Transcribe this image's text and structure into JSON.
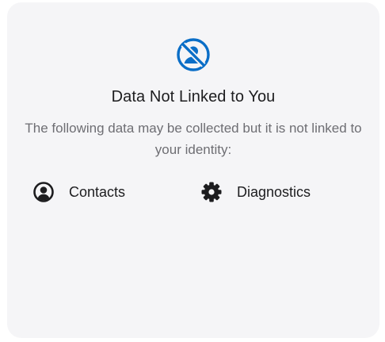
{
  "card": {
    "title": "Data Not Linked to You",
    "description": "The following data may be collected but it is not linked to your identity:",
    "header_icon": "unlinked-person-icon",
    "accent_color": "#0a6ec7",
    "items": [
      {
        "label": "Contacts",
        "icon": "person-circle-icon"
      },
      {
        "label": "Diagnostics",
        "icon": "gear-icon"
      }
    ]
  }
}
